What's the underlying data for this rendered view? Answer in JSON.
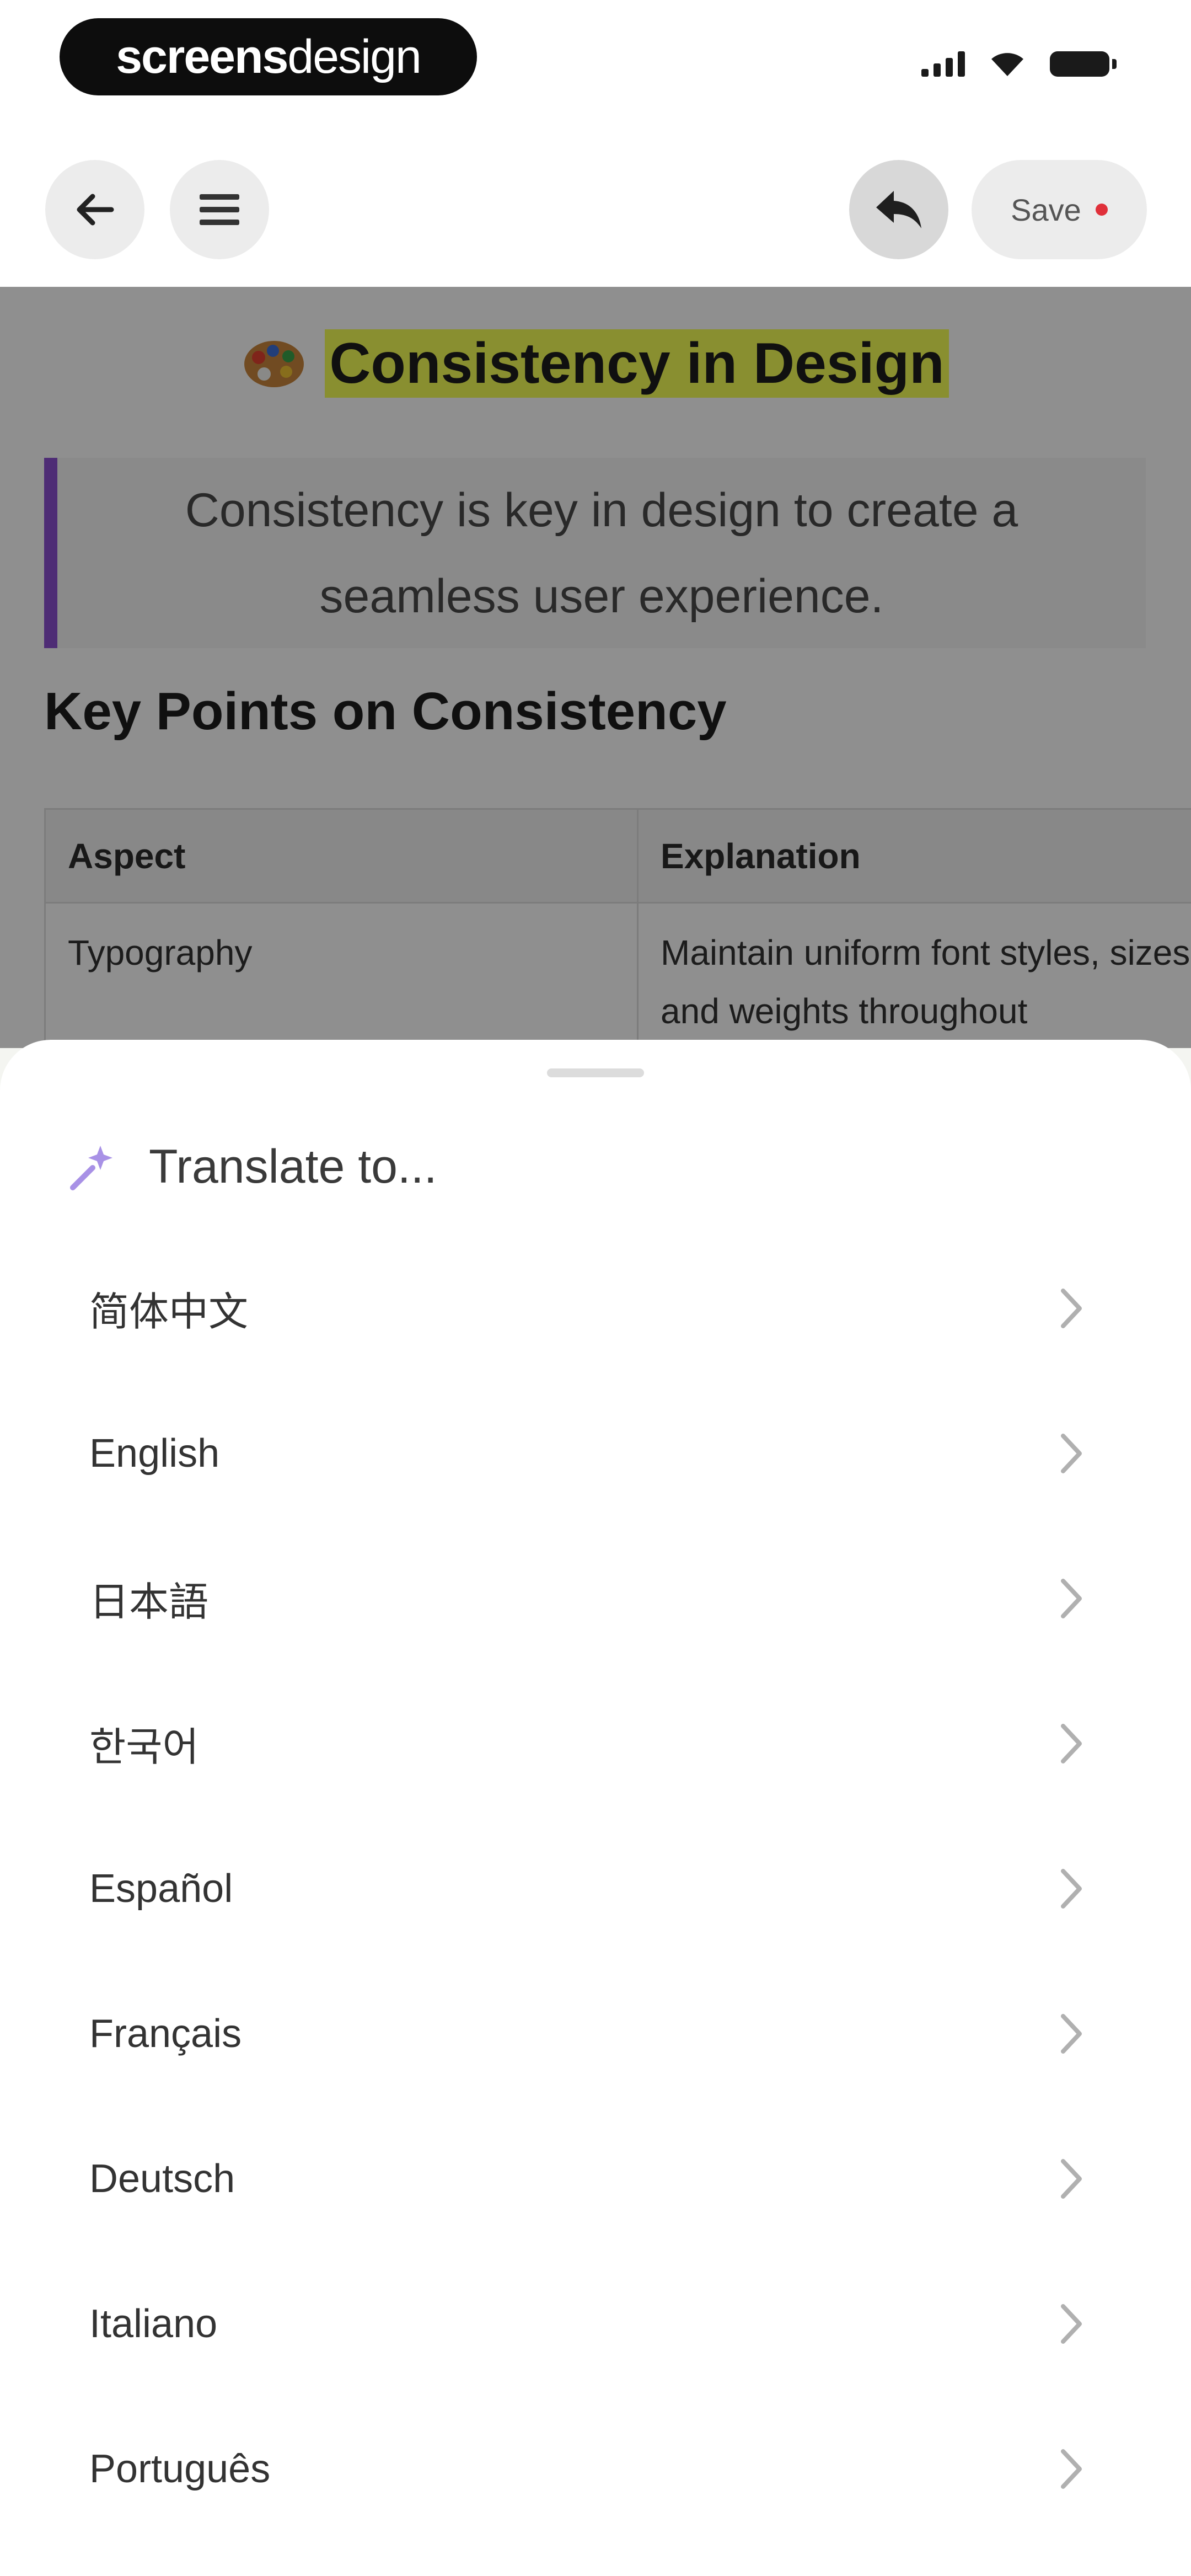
{
  "status_bar": {
    "brand_bold": "screens",
    "brand_light": "design"
  },
  "toolbar": {
    "save_label": "Save"
  },
  "document": {
    "title": "Consistency in Design",
    "quote": "Consistency is key in design to create a seamless user experience.",
    "section_heading": "Key Points on Consistency",
    "table": {
      "headers": [
        "Aspect",
        "Explanation"
      ],
      "rows": [
        [
          "Typography",
          "Maintain uniform font styles, sizes, and weights throughout"
        ]
      ]
    }
  },
  "sheet": {
    "title": "Translate to...",
    "languages": [
      "简体中文",
      "English",
      "日本語",
      "한국어",
      "Español",
      "Français",
      "Deutsch",
      "Italiano",
      "Português"
    ]
  },
  "colors": {
    "accent_purple": "#8b4fd1",
    "highlight_yellow": "#f4ff57",
    "save_dot_red": "#e0303a"
  }
}
